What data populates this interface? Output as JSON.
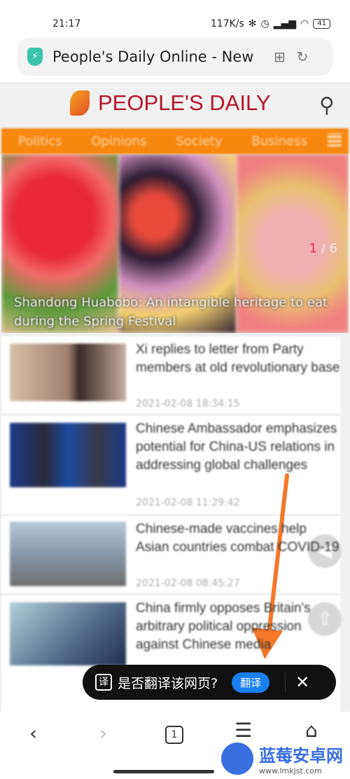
{
  "status": {
    "time": "21:17",
    "speed": "117K/s",
    "battery": "41"
  },
  "urlbar": {
    "title": "People's Daily Online - New"
  },
  "site": {
    "logo": "PEOPLE'S DAILY",
    "nav": [
      "Politics",
      "Opinions",
      "Society",
      "Business"
    ]
  },
  "slider": {
    "caption": "Shandong Huabobo: An intangible heritage to eat during the Spring Festival",
    "current": "1",
    "total": "/ 6"
  },
  "articles": [
    {
      "title": "Xi replies to letter from Party members at old revolutionary base",
      "date": "2021-02-08 18:34:15"
    },
    {
      "title": "Chinese Ambassador emphasizes potential for China-US relations in addressing global challenges",
      "date": "2021-02-08 11:29:42"
    },
    {
      "title": "Chinese-made vaccines help Asian countries combat COVID-19",
      "date": "2021-02-08 08:45:27"
    },
    {
      "title": "China firmly opposes Britain's arbitrary political oppression against Chinese media",
      "date": ""
    }
  ],
  "translate": {
    "icon": "译",
    "message": "是否翻译该网页?",
    "button": "翻译"
  },
  "bottom_nav": {
    "tab_count": "1"
  },
  "watermark": {
    "name": "蓝莓安卓网",
    "url": "www.lmkjst.com"
  },
  "colors": {
    "accent": "#f7870f",
    "brand": "#b5152b",
    "translate_button": "#1a7ff0"
  }
}
